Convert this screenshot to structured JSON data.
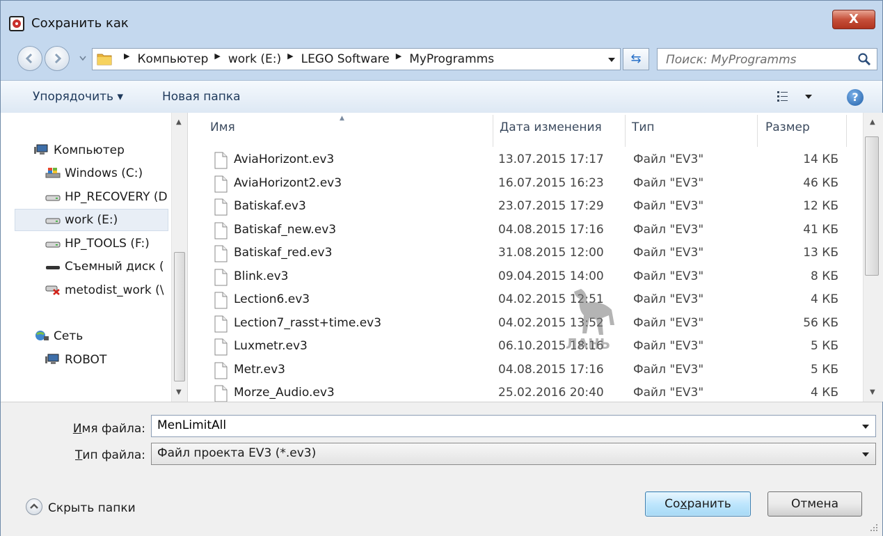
{
  "window": {
    "title": "Сохранить как",
    "close_label": "X"
  },
  "address_bar": {
    "crumbs": [
      "Компьютер",
      "work (E:)",
      "LEGO Software",
      "MyProgramms"
    ]
  },
  "search": {
    "placeholder": "Поиск: MyProgramms"
  },
  "toolbar": {
    "organize": "Упорядочить ▾",
    "new_folder": "Новая папка",
    "help": "?"
  },
  "nav": {
    "items": [
      {
        "label": "Компьютер",
        "icon": "computer-icon"
      },
      {
        "label": "Windows (C:)",
        "icon": "windows-drive-icon"
      },
      {
        "label": "HP_RECOVERY (D",
        "icon": "drive-icon"
      },
      {
        "label": "work (E:)",
        "icon": "drive-icon",
        "selected": true
      },
      {
        "label": "HP_TOOLS (F:)",
        "icon": "drive-icon"
      },
      {
        "label": "Съемный диск (",
        "icon": "removable-drive-icon"
      },
      {
        "label": "metodist_work (\\",
        "icon": "network-drive-disconnected-icon"
      },
      {
        "label": "Сеть",
        "icon": "network-icon"
      },
      {
        "label": "ROBOT",
        "icon": "computer-icon"
      }
    ]
  },
  "file_list": {
    "columns": [
      "Имя",
      "Дата изменения",
      "Тип",
      "Размер"
    ],
    "rows": [
      {
        "name": "AviaHorizont.ev3",
        "date": "13.07.2015 17:17",
        "type": "Файл \"EV3\"",
        "size": "14 КБ"
      },
      {
        "name": "AviaHorizont2.ev3",
        "date": "16.07.2015 16:23",
        "type": "Файл \"EV3\"",
        "size": "46 КБ"
      },
      {
        "name": "Batiskaf.ev3",
        "date": "23.07.2015 17:29",
        "type": "Файл \"EV3\"",
        "size": "12 КБ"
      },
      {
        "name": "Batiskaf_new.ev3",
        "date": "04.08.2015 17:16",
        "type": "Файл \"EV3\"",
        "size": "41 КБ"
      },
      {
        "name": "Batiskaf_red.ev3",
        "date": "31.08.2015 12:00",
        "type": "Файл \"EV3\"",
        "size": "13 КБ"
      },
      {
        "name": "Blink.ev3",
        "date": "09.04.2015 14:00",
        "type": "Файл \"EV3\"",
        "size": "8 КБ"
      },
      {
        "name": "Lection6.ev3",
        "date": "04.02.2015 12:51",
        "type": "Файл \"EV3\"",
        "size": "4 КБ"
      },
      {
        "name": "Lection7_rasst+time.ev3",
        "date": "04.02.2015 13:52",
        "type": "Файл \"EV3\"",
        "size": "56 КБ"
      },
      {
        "name": "Luxmetr.ev3",
        "date": "06.10.2015 18:16",
        "type": "Файл \"EV3\"",
        "size": "5 КБ"
      },
      {
        "name": "Metr.ev3",
        "date": "04.08.2015 17:16",
        "type": "Файл \"EV3\"",
        "size": "5 КБ"
      },
      {
        "name": "Morze_Audio.ev3",
        "date": "25.02.2016 20:40",
        "type": "Файл \"EV3\"",
        "size": "4 КБ"
      }
    ]
  },
  "watermark": {
    "text": "ЛАНЬ"
  },
  "form": {
    "filename_label_u": "И",
    "filename_label_rest": "мя файла:",
    "filename_value": "MenLimitAll",
    "filetype_label_u": "Т",
    "filetype_label_rest": "ип файла:",
    "filetype_value": "Файл проекта EV3 (*.ev3)"
  },
  "footer": {
    "hide_folders": "Скрыть папки",
    "save_pre": "Со",
    "save_u": "х",
    "save_post": "ранить",
    "cancel": "Отмена"
  },
  "colors": {
    "accent": "#3c7fb1",
    "close": "#c6503a",
    "frame": "#c4d8ee"
  }
}
